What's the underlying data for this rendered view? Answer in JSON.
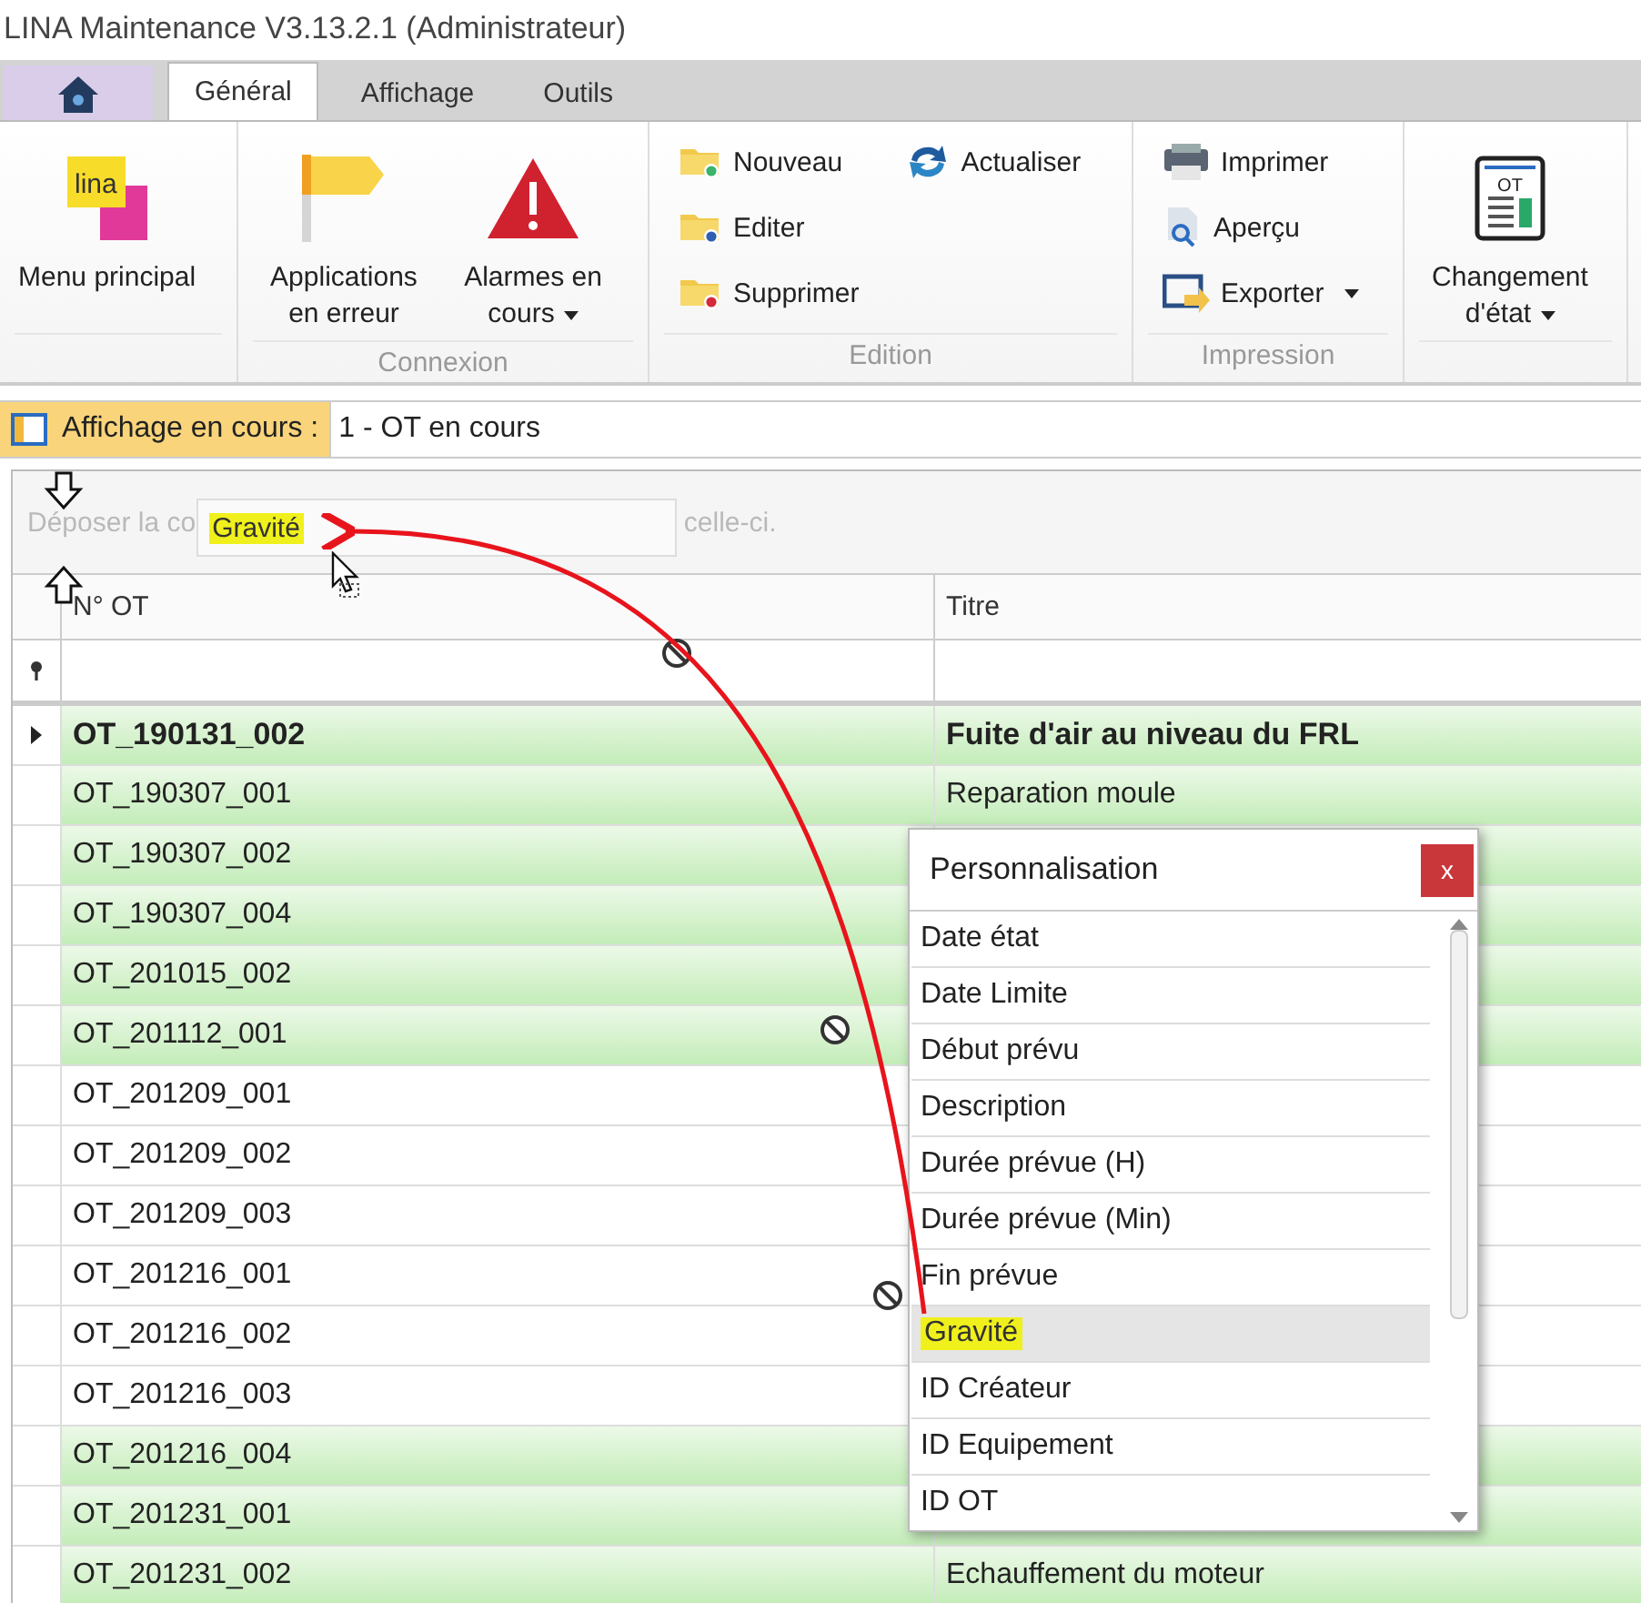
{
  "window": {
    "title": "LINA Maintenance  V3.13.2.1  (Administrateur)"
  },
  "tabs": [
    {
      "kind": "home",
      "selected": false
    },
    {
      "kind": "text",
      "label": "Général",
      "selected": true
    },
    {
      "kind": "text",
      "label": "Affichage",
      "selected": false
    },
    {
      "kind": "text",
      "label": "Outils",
      "selected": false
    }
  ],
  "ribbon": {
    "logo_text": "lina",
    "doc_icon_text": "OT",
    "groups": [
      {
        "items": [
          {
            "kind": "large",
            "label": "Menu principal",
            "dropdown": false
          }
        ]
      },
      {
        "label": "Connexion",
        "items": [
          {
            "kind": "large",
            "label": "Applications en erreur",
            "dropdown": false
          },
          {
            "kind": "large",
            "label": "Alarmes en cours",
            "dropdown": true
          }
        ]
      },
      {
        "label": "Edition",
        "items": [
          {
            "kind": "small",
            "label": "Nouveau",
            "dropdown": false
          },
          {
            "kind": "small",
            "label": "Editer",
            "dropdown": false
          },
          {
            "kind": "small",
            "label": "Supprimer",
            "dropdown": false
          },
          {
            "kind": "small",
            "label": "Actualiser",
            "dropdown": false
          }
        ]
      },
      {
        "label": "Impression",
        "items": [
          {
            "kind": "small",
            "label": "Imprimer",
            "dropdown": false
          },
          {
            "kind": "small",
            "label": "Aperçu",
            "dropdown": false
          },
          {
            "kind": "small",
            "label": "Exporter",
            "dropdown": true
          }
        ]
      },
      {
        "items": [
          {
            "kind": "large",
            "label": "Changement d'état",
            "dropdown": true
          }
        ]
      }
    ]
  },
  "current_view": {
    "label": "Affichage en cours :",
    "value": "1 - OT en cours"
  },
  "grid": {
    "drop_hint_start": "Déposer la co",
    "drag_column": "Gravité",
    "drop_hint_end": "celle-ci.",
    "columns": [
      "N° OT",
      "Titre"
    ],
    "rows": [
      {
        "ot": "OT_190131_002",
        "title": "Fuite d'air au niveau du FRL",
        "highlighted": true,
        "current": true
      },
      {
        "ot": "OT_190307_001",
        "title": "Reparation moule",
        "highlighted": true,
        "current": false
      },
      {
        "ot": "OT_190307_002",
        "highlighted": true,
        "current": false
      },
      {
        "ot": "OT_190307_004",
        "highlighted": true,
        "current": false
      },
      {
        "ot": "OT_201015_002",
        "highlighted": true,
        "current": false
      },
      {
        "ot": "OT_201112_001",
        "highlighted": true,
        "current": false
      },
      {
        "ot": "OT_201209_001",
        "highlighted": false,
        "current": false
      },
      {
        "ot": "OT_201209_002",
        "highlighted": false,
        "current": false
      },
      {
        "ot": "OT_201209_003",
        "highlighted": false,
        "current": false
      },
      {
        "ot": "OT_201216_001",
        "highlighted": false,
        "current": false
      },
      {
        "ot": "OT_201216_002",
        "highlighted": false,
        "current": false
      },
      {
        "ot": "OT_201216_003",
        "highlighted": false,
        "current": false
      },
      {
        "ot": "OT_201216_004",
        "highlighted": true,
        "current": false
      },
      {
        "ot": "OT_201231_001",
        "highlighted": true,
        "current": false
      },
      {
        "ot": "OT_201231_002",
        "title": "Echauffement du moteur",
        "highlighted": true,
        "current": false
      }
    ]
  },
  "column_chooser": {
    "title": "Personnalisation",
    "close": "x",
    "items": [
      {
        "label": "Date état",
        "selected": false
      },
      {
        "label": "Date Limite",
        "selected": false
      },
      {
        "label": "Début prévu",
        "selected": false
      },
      {
        "label": "Description",
        "selected": false
      },
      {
        "label": "Durée prévue (H)",
        "selected": false
      },
      {
        "label": "Durée prévue (Min)",
        "selected": false
      },
      {
        "label": "Fin prévue",
        "selected": false
      },
      {
        "label": "Gravité",
        "selected": true
      },
      {
        "label": "ID Créateur",
        "selected": false
      },
      {
        "label": "ID Equipement",
        "selected": false
      },
      {
        "label": "ID OT",
        "selected": false
      }
    ]
  }
}
